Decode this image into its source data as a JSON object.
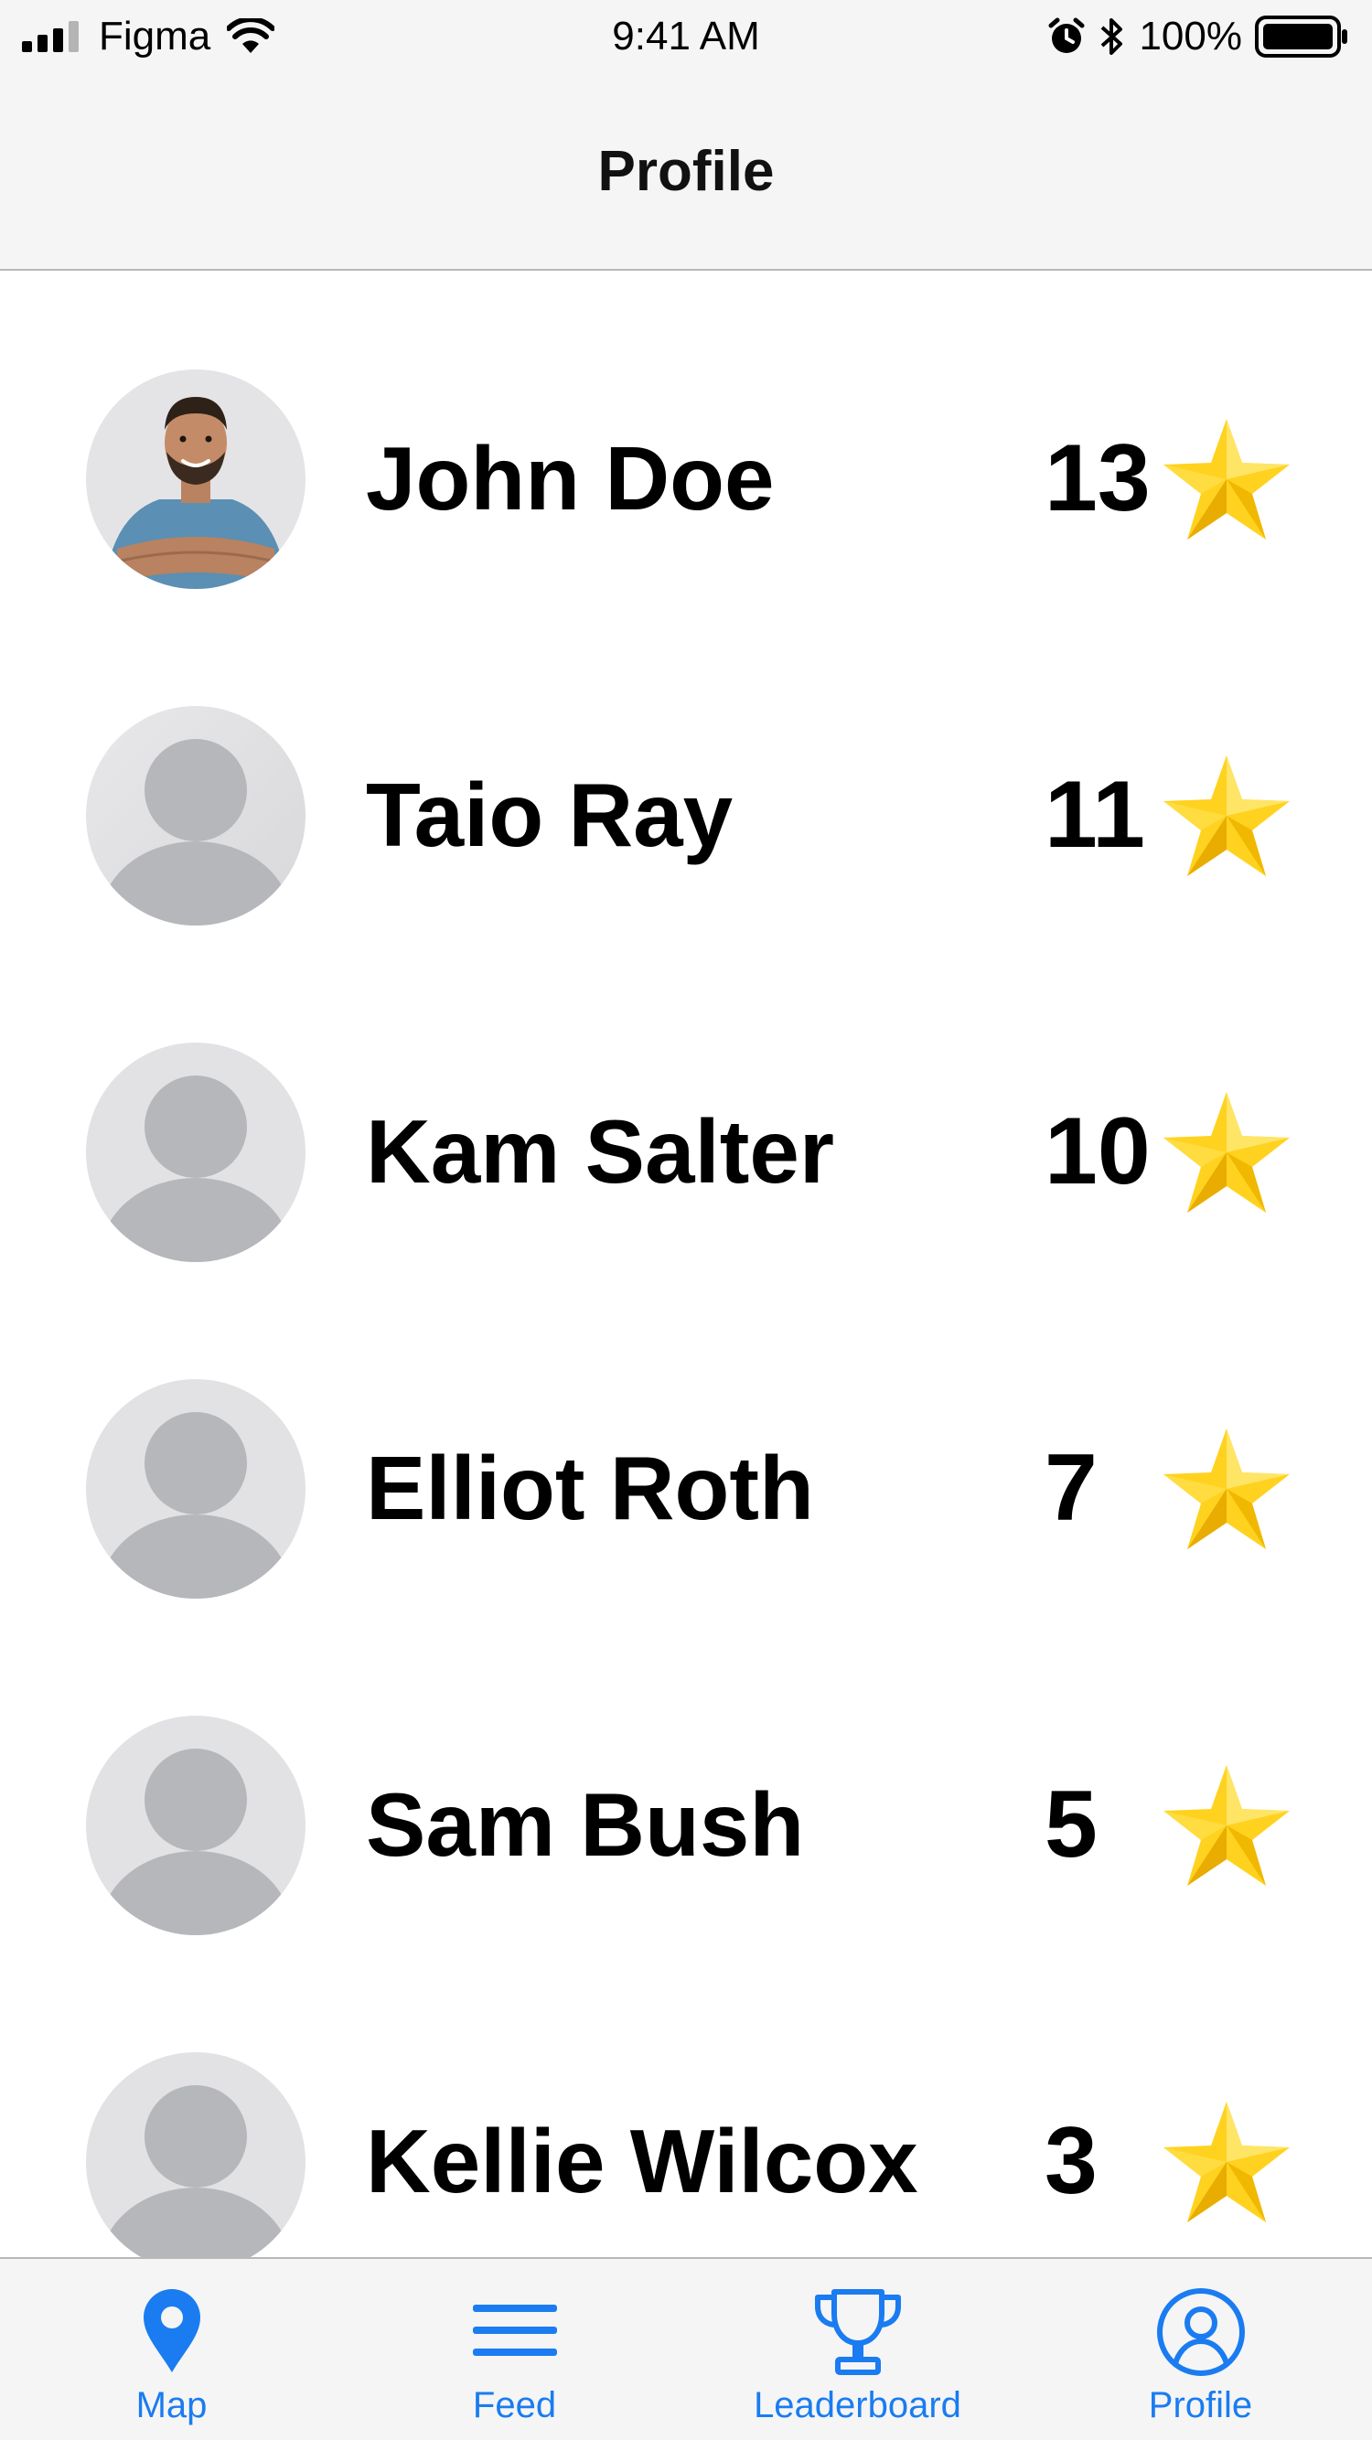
{
  "status_bar": {
    "carrier": "Figma",
    "time": "9:41 AM",
    "battery": "100%"
  },
  "nav": {
    "title": "Profile"
  },
  "leaderboard": [
    {
      "name": "John Doe",
      "score": "13",
      "avatar": "photo"
    },
    {
      "name": "Taio Ray",
      "score": "11",
      "avatar": "placeholder"
    },
    {
      "name": "Kam Salter",
      "score": "10",
      "avatar": "placeholder"
    },
    {
      "name": "Elliot Roth",
      "score": "7",
      "avatar": "placeholder"
    },
    {
      "name": "Sam Bush",
      "score": "5",
      "avatar": "placeholder"
    },
    {
      "name": "Kellie Wilcox",
      "score": "3",
      "avatar": "placeholder"
    }
  ],
  "tabs": [
    {
      "label": "Map",
      "icon": "map-pin-icon"
    },
    {
      "label": "Feed",
      "icon": "menu-lines-icon"
    },
    {
      "label": "Leaderboard",
      "icon": "trophy-icon"
    },
    {
      "label": "Profile",
      "icon": "user-circle-icon"
    }
  ],
  "colors": {
    "accent": "#1a7cf0",
    "star": "#ffd21f",
    "bar_background": "#f5f5f5"
  }
}
